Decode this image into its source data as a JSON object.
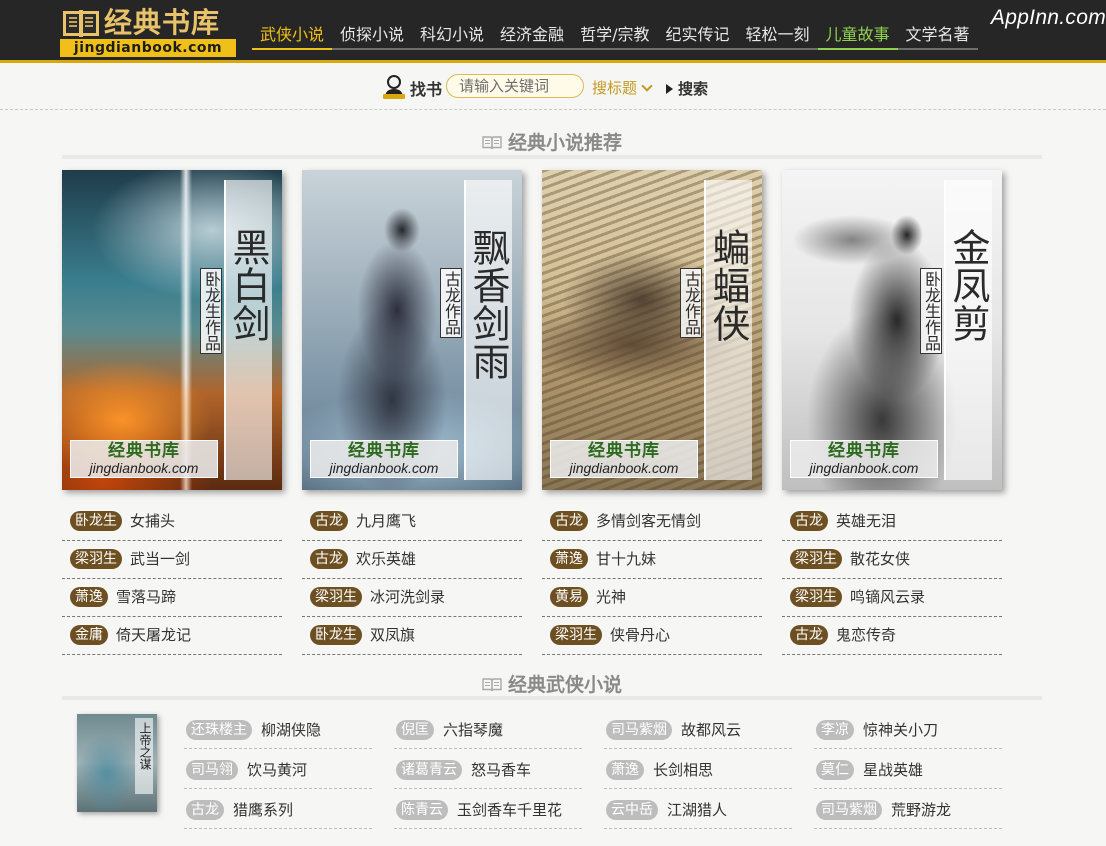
{
  "logo": {
    "title": "经典书库",
    "subtitle": "jingdianbook.com"
  },
  "watermark": "AppInn.com",
  "nav": [
    {
      "label": "武侠小说",
      "state": "active"
    },
    {
      "label": "侦探小说",
      "state": ""
    },
    {
      "label": "科幻小说",
      "state": ""
    },
    {
      "label": "经济金融",
      "state": ""
    },
    {
      "label": "哲学/宗教",
      "state": ""
    },
    {
      "label": "纪实传记",
      "state": ""
    },
    {
      "label": "轻松一刻",
      "state": ""
    },
    {
      "label": "儿童故事",
      "state": "green"
    },
    {
      "label": "文学名著",
      "state": ""
    }
  ],
  "search": {
    "label": "找书",
    "placeholder": "请输入关键词",
    "select_value": "搜标题",
    "button": "搜索"
  },
  "sections": {
    "recommend": "经典小说推荐",
    "wuxia": "经典武侠小说"
  },
  "covers": [
    {
      "title": "黑白剑",
      "author": "卧龙生作品",
      "stamp_cn": "经典书库",
      "stamp_en": "jingdianbook.com"
    },
    {
      "title": "飘香剑雨",
      "author": "古龙作品",
      "stamp_cn": "经典书库",
      "stamp_en": "jingdianbook.com"
    },
    {
      "title": "蝙蝠侠",
      "author": "古龙作品",
      "stamp_cn": "经典书库",
      "stamp_en": "jingdianbook.com"
    },
    {
      "title": "金凤剪",
      "author": "卧龙生作品",
      "stamp_cn": "经典书库",
      "stamp_en": "jingdianbook.com"
    }
  ],
  "recommend_list": [
    [
      {
        "author": "卧龙生",
        "title": "女捕头"
      },
      {
        "author": "梁羽生",
        "title": "武当一剑"
      },
      {
        "author": "萧逸",
        "title": "雪落马蹄"
      },
      {
        "author": "金庸",
        "title": "倚天屠龙记"
      }
    ],
    [
      {
        "author": "古龙",
        "title": "九月鹰飞"
      },
      {
        "author": "古龙",
        "title": "欢乐英雄"
      },
      {
        "author": "梁羽生",
        "title": "冰河洗剑录"
      },
      {
        "author": "卧龙生",
        "title": "双凤旗"
      }
    ],
    [
      {
        "author": "古龙",
        "title": "多情剑客无情剑"
      },
      {
        "author": "萧逸",
        "title": "甘十九妹"
      },
      {
        "author": "黄易",
        "title": "光神"
      },
      {
        "author": "梁羽生",
        "title": "侠骨丹心"
      }
    ],
    [
      {
        "author": "古龙",
        "title": "英雄无泪"
      },
      {
        "author": "梁羽生",
        "title": "散花女侠"
      },
      {
        "author": "梁羽生",
        "title": "鸣镝风云录"
      },
      {
        "author": "古龙",
        "title": "鬼恋传奇"
      }
    ]
  ],
  "wuxia_thumb": {
    "title": "上帝之谋"
  },
  "wuxia_list": [
    [
      {
        "author": "还珠楼主",
        "title": "柳湖侠隐"
      },
      {
        "author": "司马翎",
        "title": "饮马黄河"
      },
      {
        "author": "古龙",
        "title": "猎鹰系列"
      }
    ],
    [
      {
        "author": "倪匡",
        "title": "六指琴魔"
      },
      {
        "author": "诸葛青云",
        "title": "怒马香车"
      },
      {
        "author": "陈青云",
        "title": "玉剑香车千里花"
      }
    ],
    [
      {
        "author": "司马紫烟",
        "title": "故都风云"
      },
      {
        "author": "萧逸",
        "title": "长剑相思"
      },
      {
        "author": "云中岳",
        "title": "江湖猎人"
      }
    ],
    [
      {
        "author": "李凉",
        "title": "惊神关小刀"
      },
      {
        "author": "莫仁",
        "title": "星战英雄"
      },
      {
        "author": "司马紫烟",
        "title": "荒野游龙"
      }
    ]
  ],
  "colors": {
    "topbar": "#262626",
    "accent": "#f0c018",
    "nav_green": "#8fd14f",
    "tag_brown": "#6d4f22",
    "tag_gray": "#bdbdbd"
  }
}
